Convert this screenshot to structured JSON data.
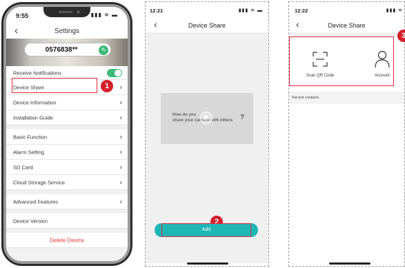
{
  "panel1": {
    "status_time": "9:55",
    "status_icons": "▮▮▮ ≋ ▬",
    "back_glyph": "‹",
    "title": "Settings",
    "device_id": "0576838**",
    "rows": [
      {
        "label": "Receive Notifications",
        "control": "toggle"
      },
      {
        "label": "Device Share",
        "control": "chevron"
      },
      {
        "label": "Device Information",
        "control": "chevron"
      },
      {
        "label": "Installation Guide",
        "control": "chevron"
      },
      {
        "label": "Basic Function",
        "control": "chevron"
      },
      {
        "label": "Alarm Setting",
        "control": "chevron"
      },
      {
        "label": "SD Card",
        "control": "chevron"
      },
      {
        "label": "Cloud Storage Service",
        "control": "chevron"
      },
      {
        "label": "Advanced Features",
        "control": "chevron"
      },
      {
        "label": "Device Version",
        "control": "none"
      }
    ],
    "delete_label": "Delete Device",
    "chevron_glyph": "›",
    "badge": "1"
  },
  "panel2": {
    "status_time": "12:21",
    "status_icons": "▮▮▮ ≋ ▬",
    "back_glyph": "‹",
    "title": "Device Share",
    "video_text_line1": "How do you",
    "video_text_line2": "share your camera with others",
    "video_q": "?",
    "add_label": "Add",
    "badge": "2"
  },
  "panel3": {
    "status_time": "12:22",
    "status_icons": "▮▮▮ ≋",
    "back_glyph": "‹",
    "title": "Device Share",
    "scan_label": "Scan QR Code",
    "account_label": "Account",
    "recent_label": "Recent contacts",
    "badge": "3"
  },
  "colors": {
    "accent_green": "#3dba7a",
    "add_teal": "#1fb6b6",
    "highlight_red": "#e0263a",
    "delete_red": "#e53935"
  }
}
